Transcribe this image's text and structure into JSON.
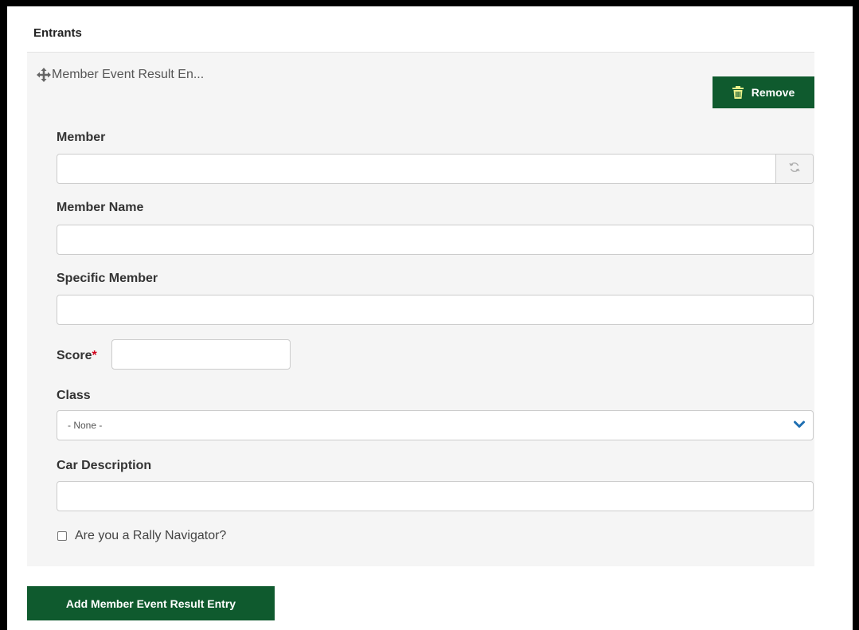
{
  "section": {
    "title": "Entrants"
  },
  "entry": {
    "header_title": "Member Event Result En...",
    "remove_label": "Remove",
    "fields": {
      "member": {
        "label": "Member",
        "value": ""
      },
      "member_name": {
        "label": "Member Name",
        "value": ""
      },
      "specific_member": {
        "label": "Specific Member",
        "value": ""
      },
      "score": {
        "label": "Score",
        "required_mark": "*",
        "value": ""
      },
      "class": {
        "label": "Class",
        "selected": "- None -"
      },
      "car_description": {
        "label": "Car Description",
        "value": ""
      },
      "rally_navigator": {
        "label": "Are you a Rally Navigator?",
        "checked": false
      }
    }
  },
  "add_button_label": "Add Member Event Result Entry",
  "icons": {
    "move": "move-arrows-icon",
    "trash": "trash-icon",
    "refresh": "refresh-icon",
    "chevron": "chevron-down-icon"
  },
  "colors": {
    "button_bg": "#0f5a2e",
    "panel_bg": "#f5f5f5",
    "required": "#d0021b",
    "chevron": "#1f6fb2"
  }
}
